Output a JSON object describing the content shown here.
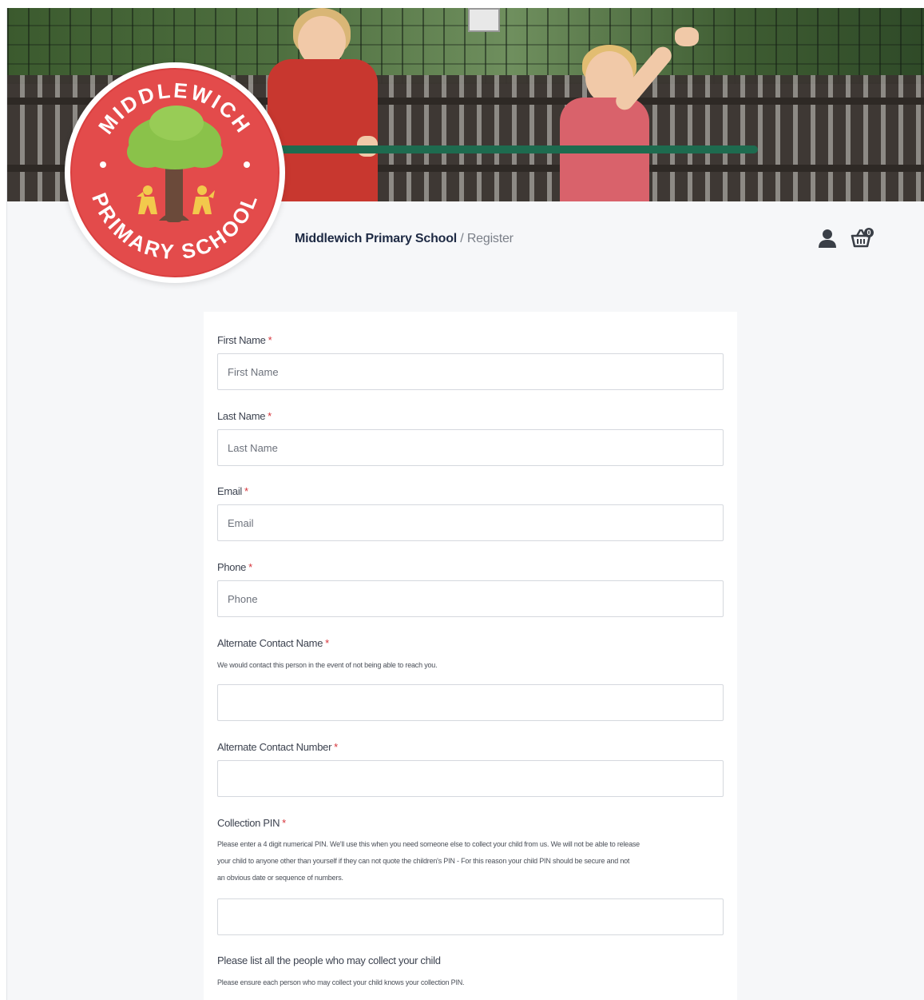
{
  "brand": {
    "logo_line_top": "MIDDLEWICH",
    "logo_line_bottom": "PRIMARY SCHOOL",
    "colors": {
      "logo_red": "#e34b4b",
      "tree_green": "#8ac24a",
      "trunk": "#6b4a3a",
      "navy": "#1e2a44",
      "required": "#d6333a"
    }
  },
  "breadcrumb": {
    "school": "Middlewich Primary School",
    "separator": " / ",
    "current": "Register"
  },
  "header": {
    "icons": [
      "user-icon",
      "basket-icon"
    ],
    "basket_count": "0"
  },
  "form": {
    "first_name": {
      "label": "First Name",
      "required": "*",
      "placeholder": "First Name"
    },
    "last_name": {
      "label": "Last Name",
      "required": "*",
      "placeholder": "Last Name"
    },
    "email": {
      "label": "Email",
      "required": "*",
      "placeholder": "Email"
    },
    "phone": {
      "label": "Phone",
      "required": "*",
      "placeholder": "Phone"
    },
    "alt_contact_name": {
      "label": "Alternate Contact Name",
      "required": "*",
      "help": "We would contact this person in the event of not being able to reach you.",
      "placeholder": ""
    },
    "alt_contact_number": {
      "label": "Alternate Contact Number",
      "required": "*",
      "placeholder": ""
    },
    "collection_pin": {
      "label": "Collection PIN",
      "required": "*",
      "help_line1": "Please enter a 4 digit numerical PIN. We'll use this when you need someone else to collect your child from us. We will not be able to release",
      "help_line2": "your child to anyone other than yourself if they can not quote the children's PIN - For this reason your child PIN should be secure and not",
      "help_line3": "an obvious date or sequence of numbers.",
      "placeholder": ""
    },
    "collectors": {
      "label": "Please list all the people who may collect your child",
      "help": "Please ensure each person who may collect your child knows your collection PIN."
    }
  }
}
